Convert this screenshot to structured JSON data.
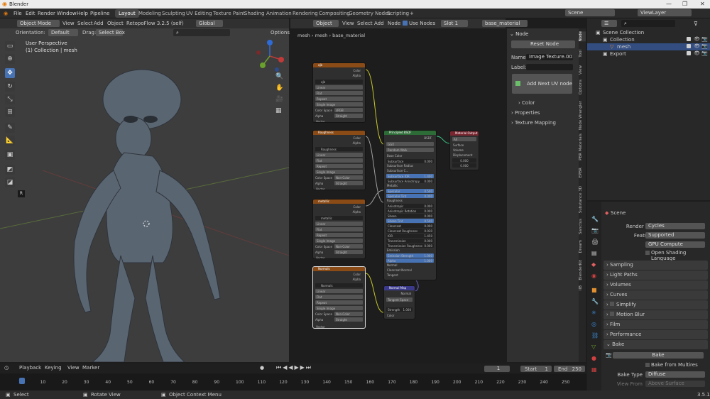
{
  "window": {
    "title": "Blender"
  },
  "menu": [
    "File",
    "Edit",
    "Render",
    "Window",
    "Help",
    "Pipeline"
  ],
  "workspaces": [
    "Layout",
    "Modeling",
    "Sculpting",
    "UV Editing",
    "Texture Paint",
    "Shading",
    "Animation",
    "Rendering",
    "Compositing",
    "Geometry Nodes",
    "Scripting"
  ],
  "active_workspace": "Layout",
  "scene_name": "Scene",
  "view_layer": "ViewLayer",
  "viewport": {
    "mode": "Object Mode",
    "menus": [
      "View",
      "Select",
      "Add",
      "Object"
    ],
    "addon": "RetopoFlow 3.2.5 (self)",
    "transform": "Global",
    "orientation_label": "Orientation:",
    "orientation": "Default",
    "drag_label": "Drag:",
    "drag": "Select Box",
    "options": "Options",
    "perspective": "User Perspective",
    "collection_info": "(1) Collection | mesh"
  },
  "node_editor": {
    "type": "Object",
    "menus": [
      "View",
      "Select",
      "Add",
      "Node"
    ],
    "use_nodes": "Use Nodes",
    "slot": "Slot 1",
    "material": "base_material",
    "breadcrumb": [
      "mesh",
      "mesh",
      "base_material"
    ],
    "texture_nodes": [
      {
        "name": "ojb",
        "colorspace": "sRGB",
        "alpha": "Straight"
      },
      {
        "name": "Roughness",
        "colorspace": "Non-Color",
        "alpha": "Straight"
      },
      {
        "name": "metallic",
        "colorspace": "Non-Color",
        "alpha": "Straight"
      },
      {
        "name": "Normals",
        "colorspace": "Non-Color",
        "alpha": "Straight"
      }
    ],
    "texture_rows": [
      "Linear",
      "Flat",
      "Repeat",
      "Single Image"
    ],
    "tex_labels": {
      "color": "Color",
      "alpha": "Alpha",
      "vector": "Vector",
      "colorspace": "Color Space",
      "alpha_mode": "Alpha"
    },
    "bsdf": {
      "title": "Principled BSDF",
      "output": "BSDF",
      "dist": "GGX",
      "sss_method": "Random Walk",
      "rows": [
        [
          "Base Color",
          ""
        ],
        [
          "Subsurface",
          "0.000"
        ],
        [
          "Subsurface Radius",
          ""
        ],
        [
          "Subsurface C...",
          ""
        ],
        [
          "Subsurface IOR",
          "1.400"
        ],
        [
          "Subsurface Anisotropy",
          "0.000"
        ],
        [
          "Metallic",
          ""
        ],
        [
          "Specular",
          "0.500"
        ],
        [
          "Specular Tint",
          "0.000"
        ],
        [
          "Roughness",
          ""
        ],
        [
          "Anisotropic",
          "0.000"
        ],
        [
          "Anisotropic Rotation",
          "0.000"
        ],
        [
          "Sheen",
          "0.000"
        ],
        [
          "Sheen Tint",
          "0.500"
        ],
        [
          "Clearcoat",
          "0.000"
        ],
        [
          "Clearcoat Roughness",
          "0.030"
        ],
        [
          "IOR",
          "1.450"
        ],
        [
          "Transmission",
          "0.000"
        ],
        [
          "Transmission Roughness",
          "0.000"
        ],
        [
          "Emission",
          ""
        ],
        [
          "Emission Strength",
          "1.000"
        ],
        [
          "Alpha",
          "1.000"
        ],
        [
          "Normal",
          ""
        ],
        [
          "Clearcoat Normal",
          ""
        ],
        [
          "Tangent",
          ""
        ]
      ]
    },
    "output_node": {
      "title": "Material Output",
      "target": "All",
      "sockets": [
        "Surface",
        "Volume",
        "Displacement"
      ],
      "values": [
        "0.000",
        "0.000"
      ]
    },
    "normal_map": {
      "title": "Normal Map",
      "output": "Normal",
      "space": "Tangent Space",
      "strength_label": "Strength",
      "strength": "1.000",
      "input": "Color"
    }
  },
  "n_panel": {
    "section": "Node",
    "reset": "Reset Node",
    "name_label": "Name:",
    "name": "Image Texture.001",
    "label_label": "Label:",
    "add_uv": "Add Next UV node",
    "color": "Color",
    "properties": "Properties",
    "texture_mapping": "Texture Mapping"
  },
  "vertical_tabs": [
    "Node",
    "Tool",
    "View",
    "Options",
    "Node Wrangler",
    "PBR Materials",
    "EPBR",
    "Substance 3D",
    "Sanctus",
    "Dream",
    "BlenderKit",
    "IIB"
  ],
  "outliner": {
    "items": [
      {
        "label": "Scene Collection",
        "indent": 0
      },
      {
        "label": "Collection",
        "indent": 1
      },
      {
        "label": "mesh",
        "indent": 2
      },
      {
        "label": "Export",
        "indent": 1
      }
    ]
  },
  "properties": {
    "tab_title": "Scene",
    "render_engine_label": "Render Engine",
    "render_engine": "Cycles",
    "feature_set_label": "Feature Set",
    "feature_set": "Supported",
    "device_label": "Device",
    "device": "GPU Compute",
    "osl": "Open Shading Language",
    "panels": [
      "Sampling",
      "Light Paths",
      "Volumes",
      "Curves",
      "Simplify",
      "Motion Blur",
      "Film",
      "Performance",
      "Bake"
    ],
    "bake_button": "Bake",
    "bake_multires": "Bake from Multires",
    "bake_type_label": "Bake Type",
    "bake_type": "Diffuse",
    "view_from_label": "View From",
    "view_from": "Above Surface"
  },
  "timeline": {
    "menus": [
      "Playback",
      "Keying",
      "View",
      "Marker"
    ],
    "current": "1",
    "start_label": "Start",
    "start": "1",
    "end_label": "End",
    "end": "250",
    "ticks": [
      "1",
      "10",
      "20",
      "30",
      "40",
      "50",
      "60",
      "70",
      "80",
      "90",
      "100",
      "110",
      "120",
      "130",
      "140",
      "150",
      "160",
      "170",
      "180",
      "190",
      "200",
      "210",
      "220",
      "230",
      "240",
      "250"
    ]
  },
  "status": {
    "select": "Select",
    "rotate": "Rotate View",
    "context": "Object Context Menu",
    "version": "3.5.1"
  },
  "colors": {
    "accent": "#4772b3",
    "texture_header": "#8a4b16",
    "bsdf_header": "#2d6b37",
    "output_header": "#7a2630",
    "vector_header": "#3b3a8a"
  }
}
